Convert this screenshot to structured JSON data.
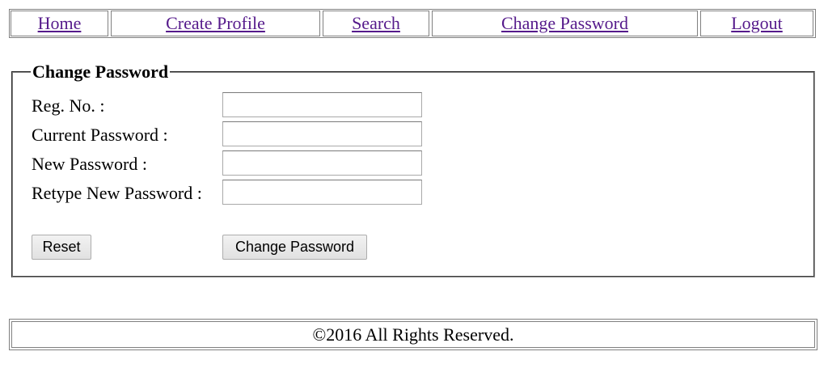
{
  "nav": {
    "home": "Home",
    "create_profile": "Create Profile",
    "search": "Search",
    "change_password": "Change Password",
    "logout": "Logout",
    "link_color": "#551a8b"
  },
  "form": {
    "legend": "Change Password",
    "fields": [
      {
        "label": "Reg. No. :",
        "value": "",
        "placeholder": ""
      },
      {
        "label": "Current Password :",
        "value": "",
        "placeholder": ""
      },
      {
        "label": "New Password :",
        "value": "",
        "placeholder": ""
      },
      {
        "label": "Retype New Password :",
        "value": "",
        "placeholder": ""
      }
    ],
    "reset_label": "Reset",
    "submit_label": "Change Password"
  },
  "footer": {
    "text": "©2016 All Rights Reserved."
  }
}
